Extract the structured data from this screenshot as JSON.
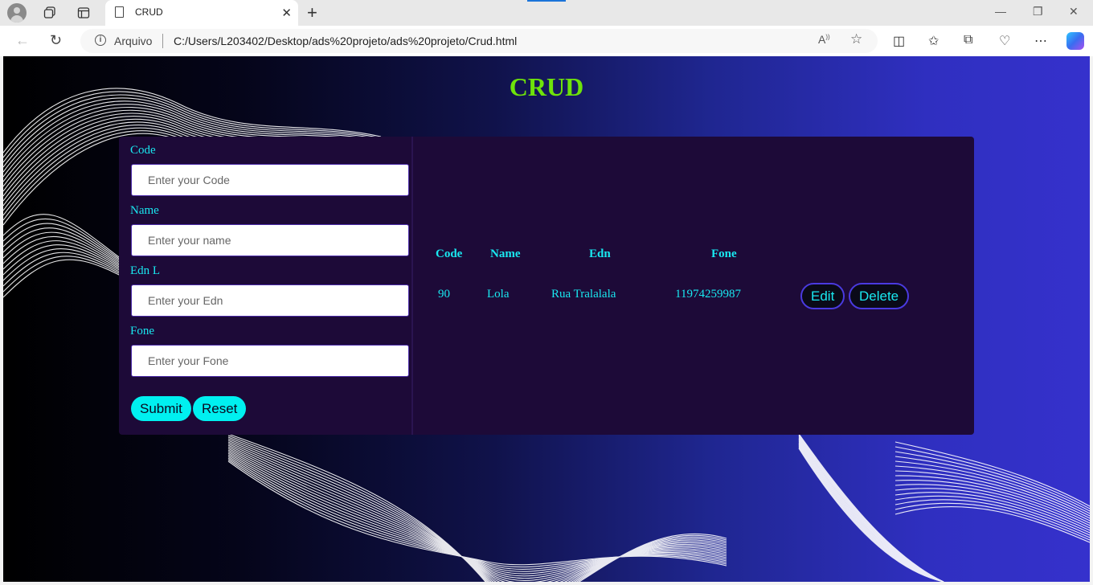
{
  "browser": {
    "tab_title": "CRUD",
    "address_prefix": "Arquivo",
    "url": "C:/Users/L203402/Desktop/ads%20projeto/ads%20projeto/Crud.html"
  },
  "page": {
    "title": "CRUD",
    "title_color": "#6ee30a",
    "accent_color": "#19e8f0"
  },
  "form": {
    "code_label": "Code",
    "code_placeholder": "Enter your Code",
    "name_label": "Name",
    "name_placeholder": "Enter your name",
    "edn_label": "Edn L",
    "edn_placeholder": "Enter your Edn",
    "fone_label": "Fone",
    "fone_placeholder": "Enter your Fone",
    "submit_label": "Submit",
    "reset_label": "Reset"
  },
  "table": {
    "headers": [
      "Code",
      "Name",
      "Edn",
      "Fone"
    ],
    "rows": [
      {
        "code": "90",
        "name": "Lola",
        "edn": "Rua Tralalala",
        "fone": "11974259987",
        "edit_label": "Edit",
        "delete_label": "Delete"
      }
    ]
  }
}
